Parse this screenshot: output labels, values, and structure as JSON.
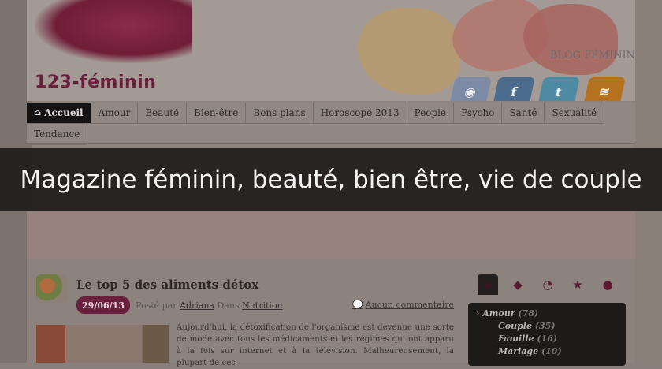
{
  "site": {
    "logo_text": "123-féminin",
    "blog_link": "BLOG FÉMININ"
  },
  "social": [
    {
      "name": "rss-icon",
      "glyph": "◉"
    },
    {
      "name": "facebook-icon",
      "glyph": "f"
    },
    {
      "name": "twitter-icon",
      "glyph": "t"
    },
    {
      "name": "feed-icon",
      "glyph": "≋"
    }
  ],
  "nav": {
    "items": [
      "Accueil",
      "Amour",
      "Beauté",
      "Bien-être",
      "Bons plans",
      "Horoscope 2013",
      "People",
      "Psycho",
      "Santé",
      "Sexualité",
      "Tendance"
    ]
  },
  "banner": {
    "text": "Magazine féminin, beauté, bien être, vie de couple"
  },
  "post": {
    "title": "Le top 5 des aliments détox",
    "date": "29/06/13",
    "posted_by": "Posté par",
    "author": "Adriana",
    "in": "Dans",
    "category": "Nutrition",
    "comments": "Aucun commentaire",
    "excerpt": "Aujourd'hui, la détoxification de l'organisme est devenue une sorte de mode avec tous les médicaments et les régimes qui ont apparu à la fois sur internet et à la télévision. Malheureusement, la plupart de ces"
  },
  "sidebar": {
    "tabs": [
      "folder-icon",
      "tag-icon",
      "clock-icon",
      "star-icon",
      "comment-icon"
    ],
    "categories": [
      {
        "label": "Amour",
        "count": "(78)",
        "level": "main"
      },
      {
        "label": "Couple",
        "count": "(35)",
        "level": "sub"
      },
      {
        "label": "Famille",
        "count": "(16)",
        "level": "sub"
      },
      {
        "label": "Mariage",
        "count": "(10)",
        "level": "sub"
      }
    ]
  },
  "colors": {
    "brand": "#6a1f3d",
    "banner_bg": "#211c1c",
    "nav_active": "#141212"
  }
}
